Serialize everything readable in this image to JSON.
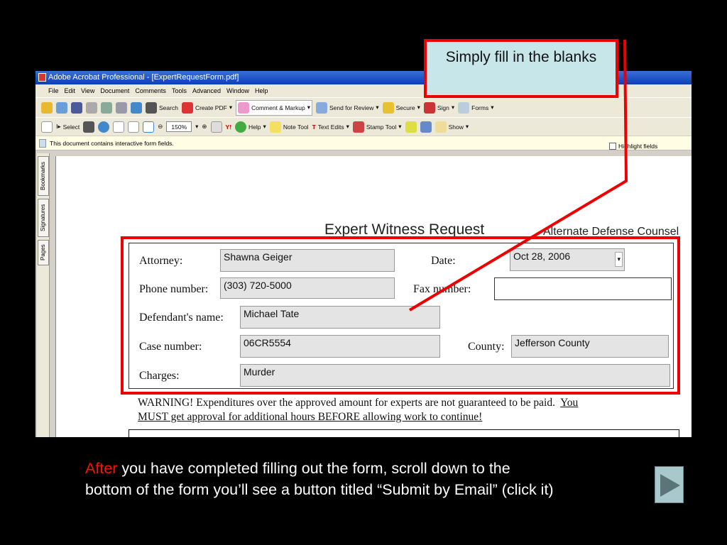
{
  "window": {
    "title": "Adobe Acrobat Professional - [ExpertRequestForm.pdf]"
  },
  "menu": [
    "File",
    "Edit",
    "View",
    "Document",
    "Comments",
    "Tools",
    "Advanced",
    "Window",
    "Help"
  ],
  "toolbar1": {
    "search": "Search",
    "create_pdf": "Create PDF",
    "comment": "Comment & Markup",
    "review": "Send for Review",
    "secure": "Secure",
    "sign": "Sign",
    "forms": "Forms"
  },
  "toolbar2": {
    "select": "Select",
    "zoom": "150%",
    "help": "Help",
    "note": "Note Tool",
    "text_edits": "Text Edits",
    "stamp": "Stamp Tool",
    "show": "Show"
  },
  "infobar": {
    "message": "This document contains interactive form fields.",
    "highlight": "Highlight fields"
  },
  "nav_tabs": [
    "Bookmarks",
    "Signatures",
    "Pages"
  ],
  "form": {
    "title": "Expert Witness Request",
    "subtitle": "Alternate Defense Counsel",
    "attorney_label": "Attorney:",
    "attorney": "Shawna Geiger",
    "date_label": "Date:",
    "date": "Oct 28, 2006",
    "phone_label": "Phone number:",
    "phone": "(303) 720-5000",
    "fax_label": "Fax number:",
    "fax": "",
    "defendant_label": "Defendant's name:",
    "defendant": "Michael Tate",
    "case_label": "Case number:",
    "case": "06CR5554",
    "county_label": "County:",
    "county": "Jefferson County",
    "charges_label": "Charges:",
    "charges": "Murder",
    "warning": "WARNING! Expenditures over the approved amount for experts are not guaranteed to be paid.",
    "warning_u1": "You",
    "warning_u2": "MUST get approval for additional hours BEFORE allowing work to continue!"
  },
  "callout": "Simply fill in the blanks",
  "caption": {
    "highlight": "After",
    "line1": " you have completed filling out the form, scroll down to the",
    "line2": "bottom of the form you’ll see a button titled “Submit by Email” (click it)"
  },
  "colors": {
    "annotation": "#e00000",
    "callout_bg": "#c6e6ea"
  }
}
